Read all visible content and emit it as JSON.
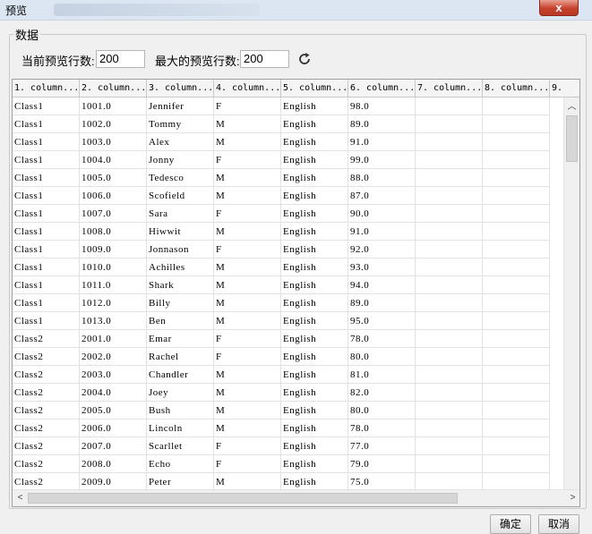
{
  "window": {
    "title": "预览",
    "close_label": "x"
  },
  "group": {
    "legend": "数据"
  },
  "preview": {
    "current_label": "当前预览行数:",
    "current_value": "200",
    "max_label": "最大的预览行数:",
    "max_value": "200"
  },
  "table": {
    "headers": [
      "1. column...",
      "2. column...",
      "3. column...",
      "4. column...",
      "5. column...",
      "6. column...",
      "7. column...",
      "8. column...",
      "9."
    ],
    "rows": [
      [
        "Class1",
        "1001.0",
        "Jennifer",
        "F",
        "English",
        "98.0"
      ],
      [
        "Class1",
        "1002.0",
        "Tommy",
        "M",
        "English",
        "89.0"
      ],
      [
        "Class1",
        "1003.0",
        "Alex",
        "M",
        "English",
        "91.0"
      ],
      [
        "Class1",
        "1004.0",
        "Jonny",
        "F",
        "English",
        "99.0"
      ],
      [
        "Class1",
        "1005.0",
        "Tedesco",
        "M",
        "English",
        "88.0"
      ],
      [
        "Class1",
        "1006.0",
        "Scofield",
        "M",
        "English",
        "87.0"
      ],
      [
        "Class1",
        "1007.0",
        "Sara",
        "F",
        "English",
        "90.0"
      ],
      [
        "Class1",
        "1008.0",
        "Hiwwit",
        "M",
        "English",
        "91.0"
      ],
      [
        "Class1",
        "1009.0",
        "Jonnason",
        "F",
        "English",
        "92.0"
      ],
      [
        "Class1",
        "1010.0",
        "Achilles",
        "M",
        "English",
        "93.0"
      ],
      [
        "Class1",
        "1011.0",
        "Shark",
        "M",
        "English",
        "94.0"
      ],
      [
        "Class1",
        "1012.0",
        "Billy",
        "M",
        "English",
        "89.0"
      ],
      [
        "Class1",
        "1013.0",
        "Ben",
        "M",
        "English",
        "95.0"
      ],
      [
        "Class2",
        "2001.0",
        "Emar",
        "F",
        "English",
        "78.0"
      ],
      [
        "Class2",
        "2002.0",
        "Rachel",
        "F",
        "English",
        "80.0"
      ],
      [
        "Class2",
        "2003.0",
        "Chandler",
        "M",
        "English",
        "81.0"
      ],
      [
        "Class2",
        "2004.0",
        "Joey",
        "M",
        "English",
        "82.0"
      ],
      [
        "Class2",
        "2005.0",
        "Bush",
        "M",
        "English",
        "80.0"
      ],
      [
        "Class2",
        "2006.0",
        "Lincoln",
        "M",
        "English",
        "78.0"
      ],
      [
        "Class2",
        "2007.0",
        "Scarllet",
        "F",
        "English",
        "77.0"
      ],
      [
        "Class2",
        "2008.0",
        "Echo",
        "F",
        "English",
        "79.0"
      ],
      [
        "Class2",
        "2009.0",
        "Peter",
        "M",
        "English",
        "75.0"
      ]
    ]
  },
  "buttons": {
    "ok": "确定",
    "cancel": "取消"
  },
  "icons": {
    "refresh": "refresh-icon",
    "close": "close-icon"
  }
}
